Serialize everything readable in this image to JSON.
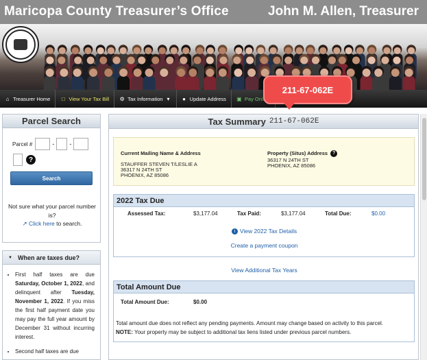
{
  "header": {
    "title": "Maricopa County Treasurer’s Office",
    "owner": "John M. Allen, Treasurer"
  },
  "seal": {
    "icon": "county-seal-icon"
  },
  "nav": {
    "items": [
      {
        "label": "Treasurer Home",
        "icon": "home-icon",
        "glyph": "⌂"
      },
      {
        "label": "View Your Tax Bill",
        "icon": "document-icon",
        "glyph": "□"
      },
      {
        "label": "Tax Information",
        "icon": "gear-icon",
        "glyph": "⚙",
        "caret": "▾"
      },
      {
        "label": "Update Address",
        "icon": "globe-icon",
        "glyph": "●"
      },
      {
        "label": "Pay Online",
        "icon": "card-icon",
        "glyph": "▣"
      }
    ]
  },
  "tooltip": {
    "text": "211-67-062E"
  },
  "parcel_search": {
    "title": "Parcel Search",
    "parcel_label": "Parcel #",
    "dash": "-",
    "search_button": "Search",
    "not_sure": "Not sure what your parcel number is?",
    "click_here": "Click here",
    "to_search": " to search."
  },
  "taxes_due": {
    "title": "When are taxes due?",
    "items": [
      "First half taxes are due Saturday, October 1, 2022, and delinquent after Tuesday, November 1, 2022. If you miss the first half payment date you may pay the full year amount by December 31 without incurring interest.",
      "Second half taxes are due"
    ]
  },
  "tax_summary": {
    "title": "Tax Summary",
    "parcel": "211-67-062E",
    "mailing_heading": "Current Mailing Name & Address",
    "mailing_lines": [
      "STAUFFER STEVEN T/LESLIE A",
      "36317 N 24TH ST",
      "PHOENIX, AZ 85086"
    ],
    "property_heading": "Property (Situs) Address",
    "property_lines": [
      "36317 N 24TH ST",
      "PHOENIX, AZ 85086"
    ],
    "tax_due": {
      "heading": "2022 Tax Due",
      "assessed_label": "Assessed Tax:",
      "assessed_value": "$3,177.04",
      "paid_label": "Tax Paid:",
      "paid_value": "$3,177.04",
      "total_label": "Total Due:",
      "total_value": "$0.00",
      "view_details": "View 2022 Tax Details",
      "create_coupon": "Create a payment coupon"
    },
    "view_additional": "View Additional Tax Years",
    "total_amount": {
      "heading": "Total Amount Due",
      "label": "Total Amount Due:",
      "value": "$0.00",
      "disclaimer": "Total amount due does not reflect any pending payments. Amount may change based on activity to this parcel.",
      "note_label": "NOTE:",
      "note_text": " Your property may be subject to additional tax liens listed under previous parcel numbers."
    }
  }
}
